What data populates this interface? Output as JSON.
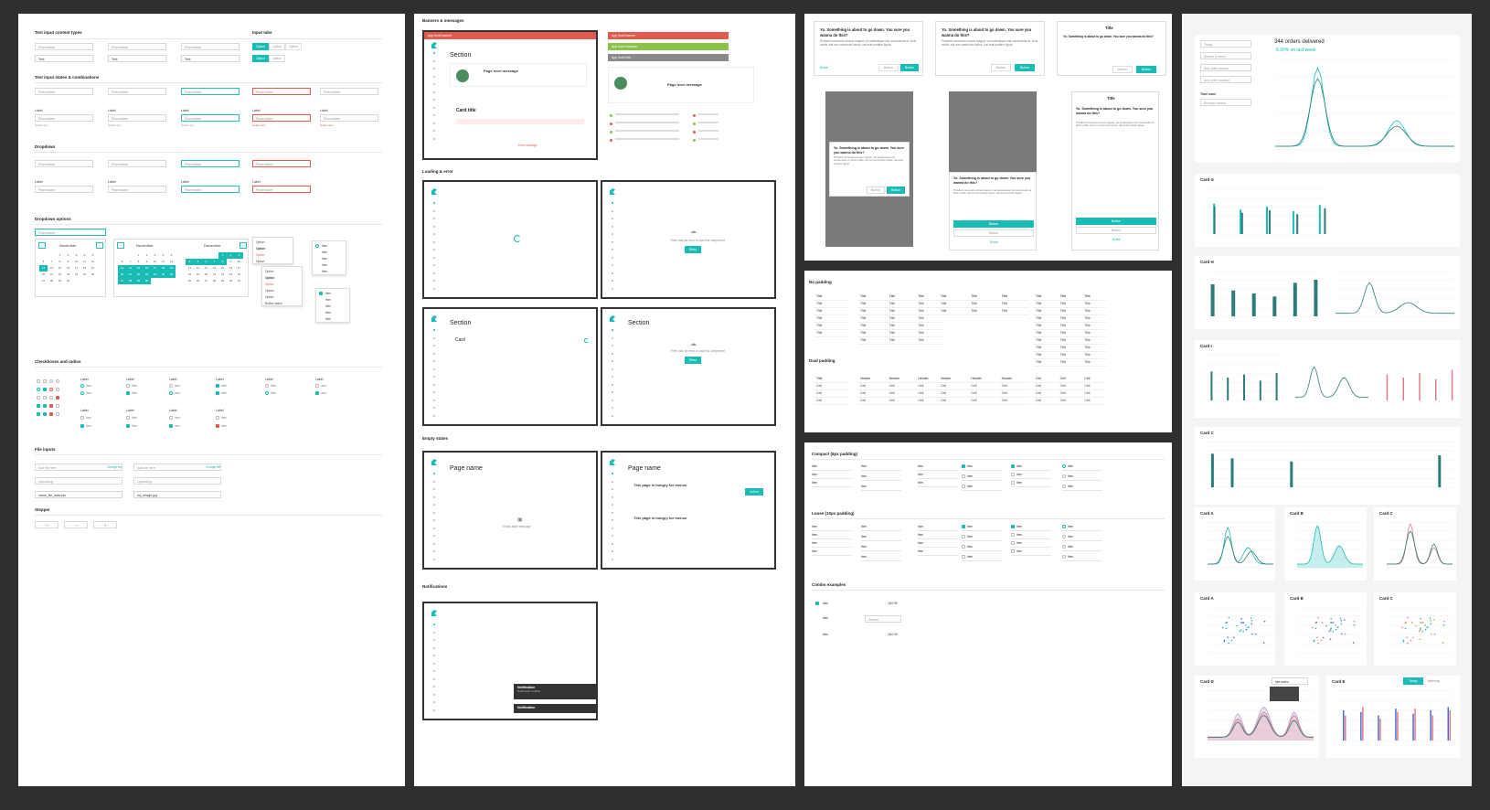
{
  "board1": {
    "sections": {
      "text_content_types": "Text input content types",
      "input_tabs": "Input tabs",
      "states_combinations": "Text input states & combinations",
      "dropdown": "Dropdown",
      "dropdown_options": "Dropdown options",
      "checkboxes_radios": "Checkboxes and radios",
      "file_inputs": "File inputs",
      "stepper": "Stepper"
    },
    "placeholder": "Placeholder",
    "text_value": "Text",
    "label": "Label",
    "helper": "Helper text",
    "tabs": [
      "Option",
      "Option",
      "Option"
    ],
    "calendar": {
      "month1": "November",
      "month2": "December"
    },
    "menu_items": [
      "Option",
      "Option",
      "Option",
      "Option"
    ],
    "menu_items2": [
      "Option",
      "Option",
      "Option",
      "Option",
      "Option",
      "Button option"
    ],
    "check_items": [
      "Item",
      "Item",
      "Item",
      "Item",
      "Item"
    ],
    "file": {
      "change": "Change file",
      "add": "Add file here",
      "uploading": "Uploading",
      "filename1": "name_file_data.csv",
      "filename2": "my_image.jpg"
    }
  },
  "board2": {
    "sections": {
      "banners": "Banners & messages",
      "loading": "Loading & error",
      "empty": "Empty states",
      "notifications": "Notifications"
    },
    "banner_labels": [
      "App level banner",
      "App level success",
      "App level info"
    ],
    "section_title": "Section",
    "page_level": "Page level message",
    "card_title": "Card title",
    "card": "Card",
    "error_message": "Error message",
    "retry": "Retry",
    "retry_text": "There was an error to load this component",
    "page_name": "Page name",
    "hungry": "This page is hungry for menus",
    "action": "Action",
    "empty_msg": "Empty state message",
    "notification": "Notification",
    "notification_sub": "Notification subtitle"
  },
  "board3": {
    "modal_title": "Yo. Something is about to go down. You sure you wanna do this?",
    "modal_body": "Proident commodo cursus magna, vel scelerisque nisl consectetur et. Duis mollis, est non commodo luctus, nisi erat porttitor ligula.",
    "title": "Title",
    "button": "Button",
    "sections": {
      "no_padding": "No padding",
      "dual_padding": "Dual padding",
      "compact": "Compact (5px padding)",
      "loose": "Loose (10px padding)",
      "combo": "Combo examples"
    },
    "header": "Header",
    "cell": "Cell",
    "item": "Item",
    "search": "Search",
    "price": "$10.99"
  },
  "board4": {
    "orders_title": "344 orders delivered",
    "orders_delta": "8.90% on last week",
    "filter_today": "Today",
    "filter_labels": [
      "Search a menu",
      "Any order source",
      "Any order location"
    ],
    "timezone_label": "Time zone",
    "timezone_value": "Europe/London",
    "cards": [
      "Card G",
      "Card H",
      "Card I",
      "Card C",
      "Card A",
      "Card B",
      "Card C",
      "Card A",
      "Card B",
      "Card C",
      "Card D",
      "Card E"
    ],
    "today_btn": "Today",
    "yesterday": "Yesterday",
    "tooltip_title": "Net sales",
    "legend": [
      "Label A",
      "Label B",
      "Label C"
    ]
  },
  "colors": {
    "accent": "#19bcb5",
    "error": "#e05a4f",
    "success": "#8bc34a",
    "info": "#8a8a8a",
    "background": "#2f2f2f"
  }
}
